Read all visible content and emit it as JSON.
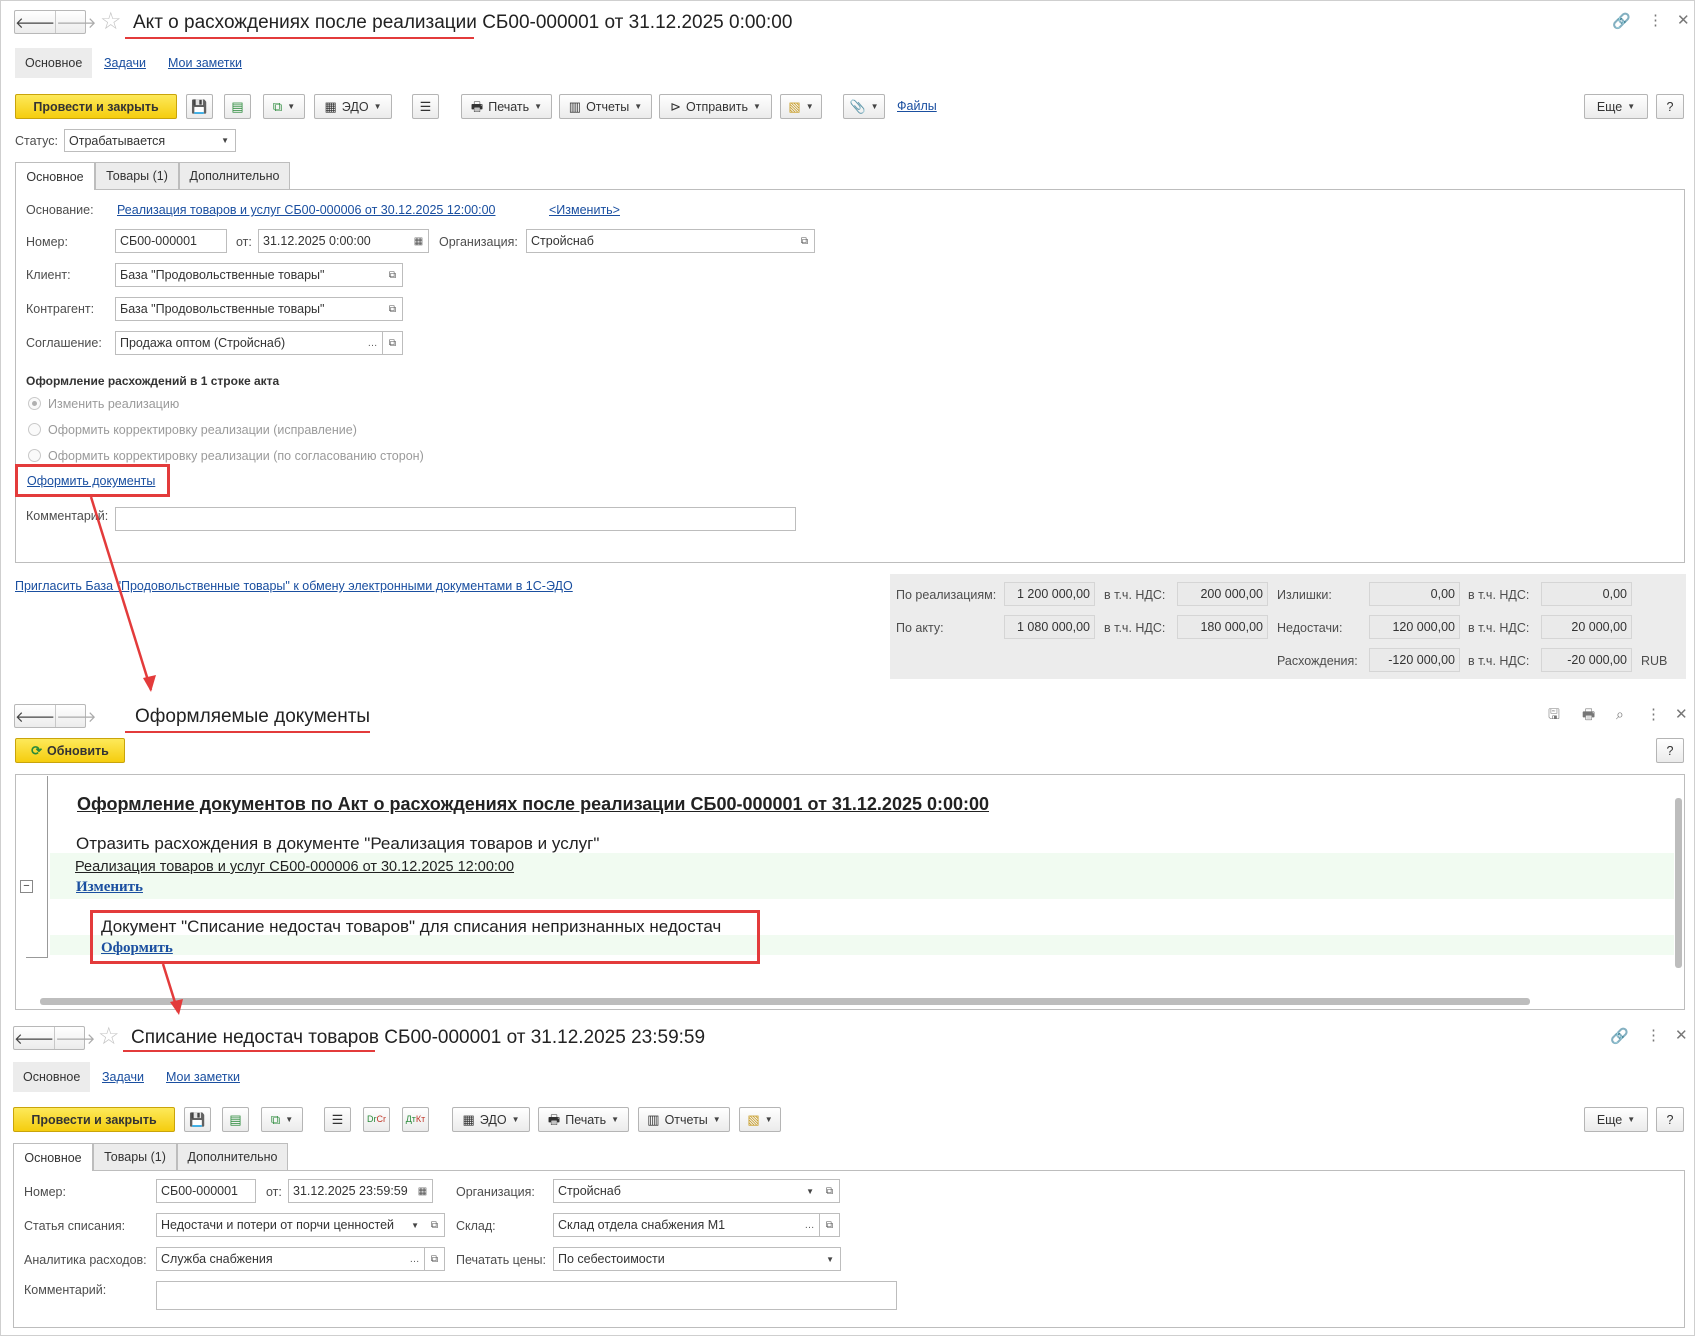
{
  "doc1": {
    "title": "Акт о расхождениях после реализации СБ00-000001 от 31.12.2025 0:00:00",
    "nav_tabs": [
      "Основное",
      "Задачи",
      "Мои заметки"
    ],
    "toolbar": {
      "post_close": "Провести и закрыть",
      "edo": "ЭДО",
      "print": "Печать",
      "reports": "Отчеты",
      "send": "Отправить",
      "files": "Файлы",
      "more": "Еще",
      "help": "?"
    },
    "status_label": "Статус:",
    "status_value": "Отрабатывается",
    "tabs": [
      "Основное",
      "Товары (1)",
      "Дополнительно"
    ],
    "basis_label": "Основание:",
    "basis_link": "Реализация товаров и услуг СБ00-000006 от 30.12.2025 12:00:00",
    "change_link": "<Изменить>",
    "number_label": "Номер:",
    "number_value": "СБ00-000001",
    "date_label": "от:",
    "date_value": "31.12.2025  0:00:00",
    "org_label": "Организация:",
    "org_value": "Стройснаб",
    "client_label": "Клиент:",
    "client_value": "База \"Продовольственные товары\"",
    "counterparty_label": "Контрагент:",
    "counterparty_value": "База \"Продовольственные товары\"",
    "agreement_label": "Соглашение:",
    "agreement_value": "Продажа оптом (Стройснаб)",
    "section_title": "Оформление расхождений в 1 строке акта",
    "radios": [
      "Изменить реализацию",
      "Оформить корректировку реализации (исправление)",
      "Оформить корректировку реализации (по согласованию сторон)"
    ],
    "make_docs_link": "Оформить документы",
    "comment_label": "Комментарий:",
    "invite_link": "Пригласить База \"Продовольственные товары\" к обмену электронными документами в 1С-ЭДО",
    "totals": {
      "by_sales_label": "По реализациям:",
      "by_sales": "1 200 000,00",
      "vat_label": "в т.ч. НДС:",
      "by_sales_vat": "200 000,00",
      "by_act_label": "По акту:",
      "by_act": "1 080 000,00",
      "by_act_vat": "180 000,00",
      "surplus_label": "Излишки:",
      "surplus": "0,00",
      "surplus_vat": "0,00",
      "shortage_label": "Недостачи:",
      "shortage": "120 000,00",
      "shortage_vat": "20 000,00",
      "diff_label": "Расхождения:",
      "diff": "-120 000,00",
      "diff_vat": "-20 000,00",
      "currency": "RUB"
    }
  },
  "report": {
    "title": "Оформляемые документы",
    "refresh": "Обновить",
    "help": "?",
    "heading": "Оформление документов по Акт о расхождениях после реализации СБ00-000001 от 31.12.2025 0:00:00",
    "line1": "Отразить расхождения в документе \"Реализация товаров и услуг\"",
    "line2": "Реализация товаров и услуг СБ00-000006 от 30.12.2025 12:00:00",
    "change": "Изменить",
    "line3": "Документ \"Списание недостач товаров\" для списания непризнанных недостач",
    "make": "Оформить"
  },
  "doc2": {
    "title": "Списание недостач товаров СБ00-000001 от 31.12.2025 23:59:59",
    "nav_tabs": [
      "Основное",
      "Задачи",
      "Мои заметки"
    ],
    "toolbar": {
      "post_close": "Провести и закрыть",
      "edo": "ЭДО",
      "print": "Печать",
      "reports": "Отчеты",
      "more": "Еще",
      "help": "?"
    },
    "tabs": [
      "Основное",
      "Товары (1)",
      "Дополнительно"
    ],
    "number_label": "Номер:",
    "number_value": "СБ00-000001",
    "date_label": "от:",
    "date_value": "31.12.2025 23:59:59",
    "org_label": "Организация:",
    "org_value": "Стройснаб",
    "article_label": "Статья списания:",
    "article_value": "Недостачи и потери от порчи ценностей",
    "warehouse_label": "Склад:",
    "warehouse_value": "Склад отдела снабжения М1",
    "analytics_label": "Аналитика расходов:",
    "analytics_value": "Служба снабжения",
    "price_label": "Печатать цены:",
    "price_value": "По себестоимости",
    "comment_label": "Комментарий:"
  }
}
